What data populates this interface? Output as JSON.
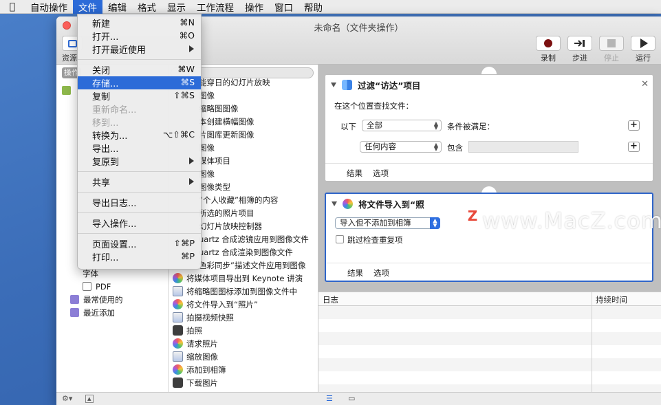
{
  "menubar": {
    "items": [
      "自动操作",
      "文件",
      "编辑",
      "格式",
      "显示",
      "工作流程",
      "操作",
      "窗口",
      "帮助"
    ]
  },
  "window": {
    "title": "未命名（文件夹操作）",
    "toolbar": {
      "library_label": "资源",
      "record": "录制",
      "step": "步进",
      "stop": "停止",
      "run": "运行"
    }
  },
  "library": {
    "header": "操作",
    "items": [
      "字体",
      "PDF",
      "最常使用的",
      "最近添加"
    ]
  },
  "actions": {
    "items": [
      "能穿日的幻灯片放映",
      "图像",
      "缩略图图像",
      "本创建横幅图像",
      "片图库更新图像",
      "图像",
      "媒体项目",
      "图像",
      "图像类型",
      "“个人收藏”相簿的内容",
      "所选的照片项目",
      "幻灯片放映控制器",
      "uartz 合成滤镜应用到图像文件",
      "uartz 合成渲染到图像文件",
      "色彩同步”描述文件应用到图像",
      "将媒体项目导出到 Keynote 讲演",
      "将缩略图图标添加到图像文件中",
      "将文件导入到“照片”",
      "拍摄视频快照",
      "拍照",
      "请求照片",
      "缩放图像",
      "添加到相簿",
      "下载图片"
    ]
  },
  "workflow": {
    "card1": {
      "title": "过滤“访达”项目",
      "find_label": "在这个位置查找文件：",
      "below_label": "以下",
      "all_value": "全部",
      "condition_label": "条件被满足：",
      "any_content_value": "任何内容",
      "contains_label": "包含",
      "results": "结果",
      "options": "选项"
    },
    "card2": {
      "title": "将文件导入到“照",
      "import_value": "导入但不添加到相簿",
      "skip_label": "跳过检查重复项",
      "results": "结果",
      "options": "选项"
    },
    "watermark": "www.MacZ.com",
    "watermark_logo": "Z"
  },
  "log": {
    "col_log": "日志",
    "col_duration": "持续时间"
  },
  "filemenu": {
    "groups": [
      [
        {
          "label": "新建",
          "shortcut": "⌘N"
        },
        {
          "label": "打开...",
          "shortcut": "⌘O"
        },
        {
          "label": "打开最近使用",
          "shortcut": ""
        }
      ],
      [
        {
          "label": "关闭",
          "shortcut": "⌘W"
        },
        {
          "label": "存储...",
          "shortcut": "⌘S"
        },
        {
          "label": "复制",
          "shortcut": "⇧⌘S"
        },
        {
          "label": "重新命名...",
          "shortcut": ""
        },
        {
          "label": "移到...",
          "shortcut": ""
        },
        {
          "label": "转换为...",
          "shortcut": "⌥⇧⌘C"
        },
        {
          "label": "导出...",
          "shortcut": ""
        },
        {
          "label": "复原到",
          "shortcut": ""
        }
      ],
      [
        {
          "label": "共享",
          "shortcut": ""
        }
      ],
      [
        {
          "label": "导出日志...",
          "shortcut": ""
        }
      ],
      [
        {
          "label": "导入操作...",
          "shortcut": ""
        }
      ],
      [
        {
          "label": "页面设置...",
          "shortcut": "⇧⌘P"
        },
        {
          "label": "打印...",
          "shortcut": "⌘P"
        }
      ]
    ]
  }
}
